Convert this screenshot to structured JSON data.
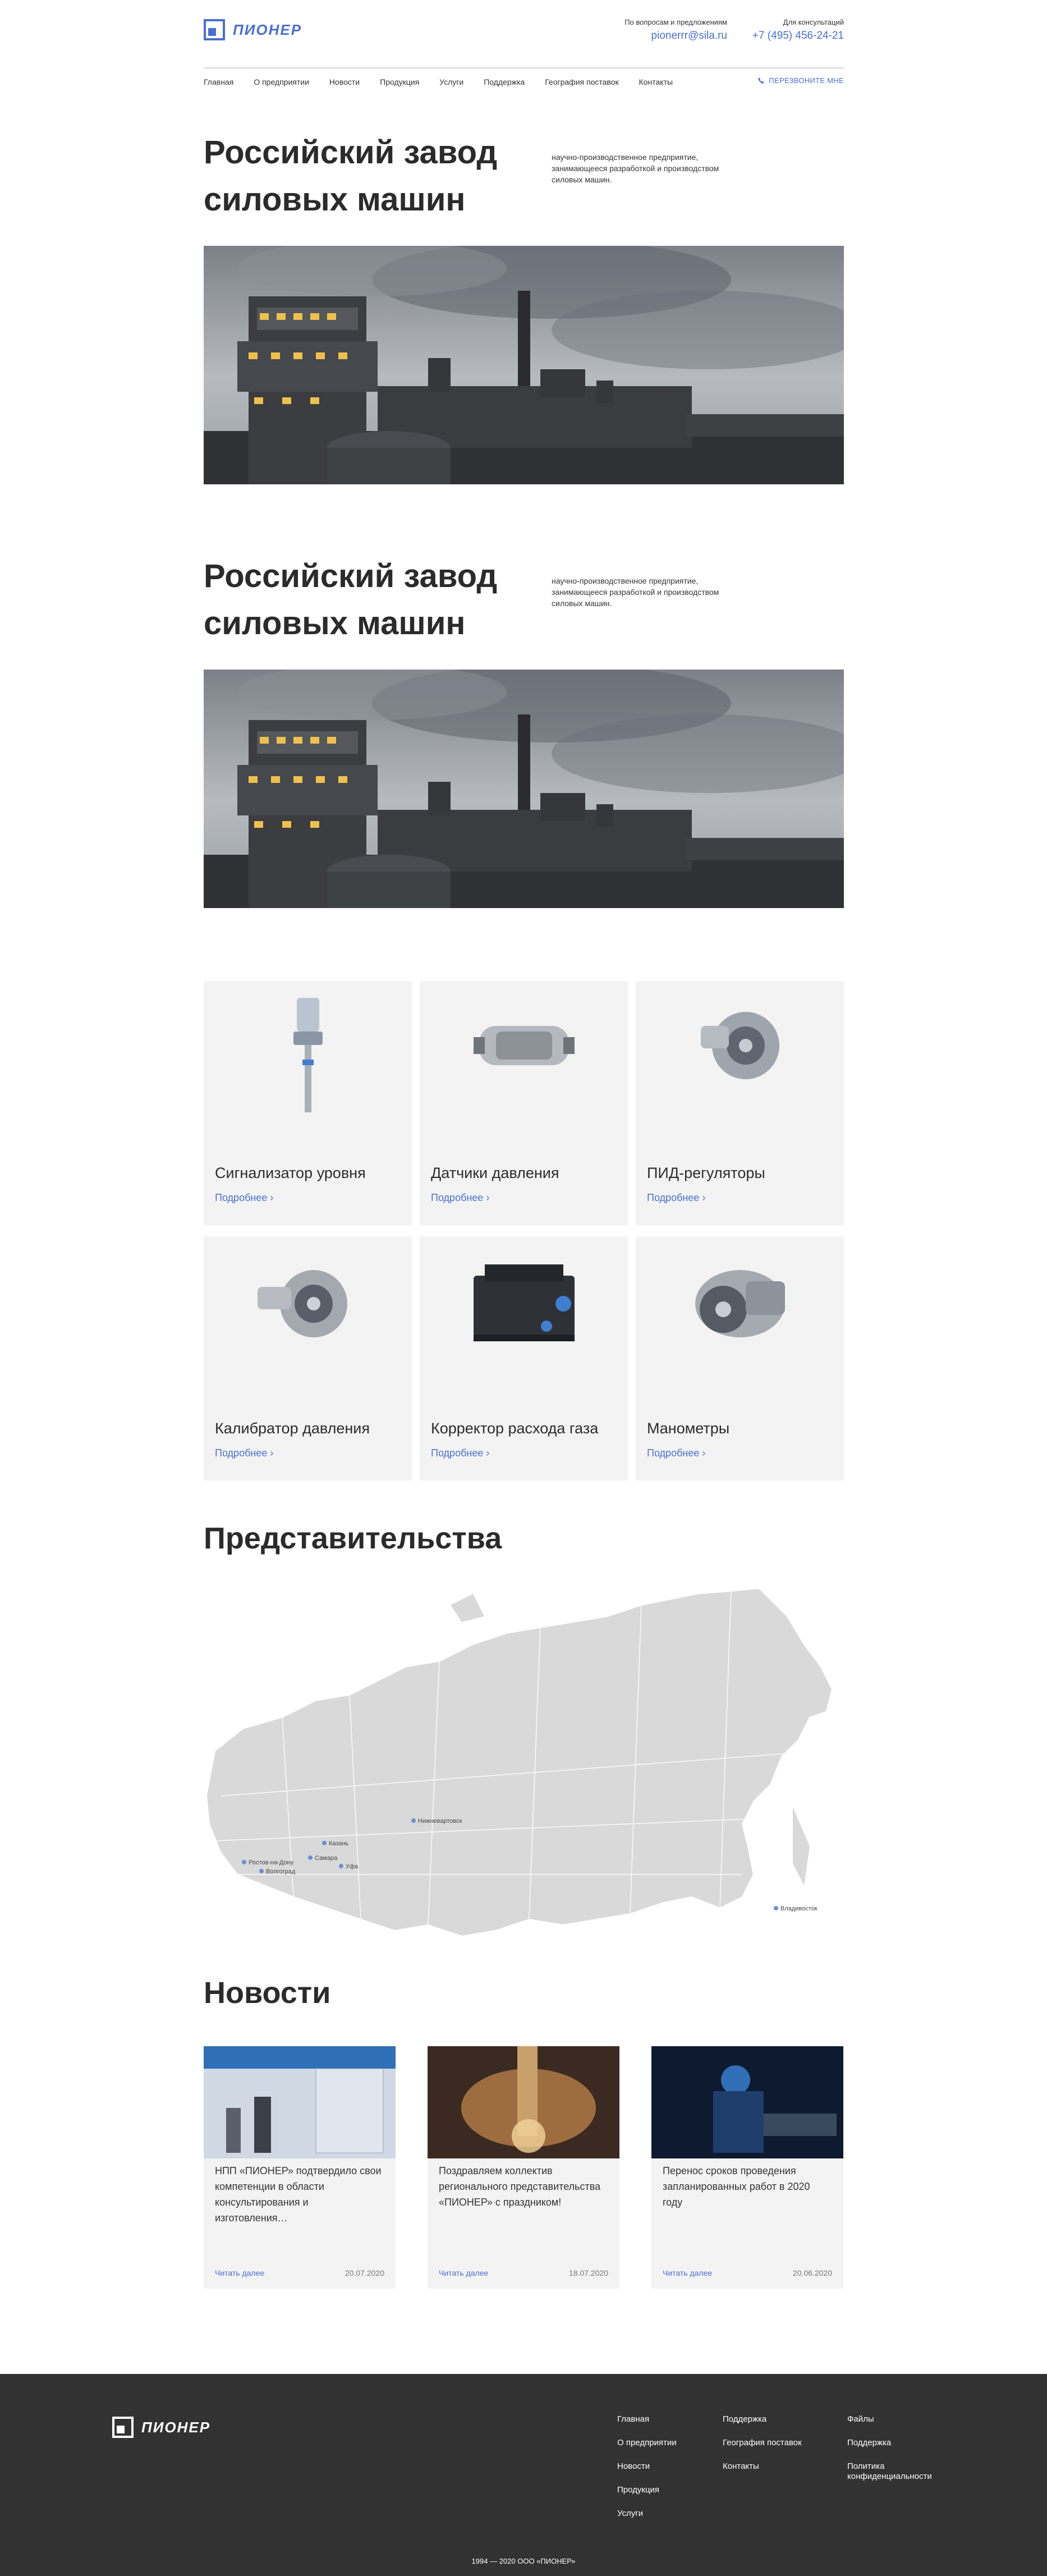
{
  "brand": {
    "name": "ПИОНЕР"
  },
  "header": {
    "email_label": "По вопросам и предложениям",
    "email": "pionerrr@sila.ru",
    "phone_label": "Для консультаций",
    "phone": "+7 (495) 456-24-21"
  },
  "nav": {
    "items": [
      "Главная",
      "О предприятии",
      "Новости",
      "Продукция",
      "Услуги",
      "Поддержка",
      "География поставок",
      "Контакты"
    ],
    "callback": "ПЕРЕЗВОНИТЕ МНЕ"
  },
  "heroes": [
    {
      "title_line1": "Российский завод",
      "title_line2": "силовых машин",
      "desc": "научно-производственное предприятие, занимающееся разработкой и производством силовых машин."
    },
    {
      "title_line1": "Российский завод",
      "title_line2": "силовых машин",
      "desc": "научно-производственное предприятие, занимающееся разработкой и производством силовых машин."
    }
  ],
  "products": [
    {
      "title": "Сигнализатор уровня",
      "more": "Подробнее",
      "icon": "level-sensor-icon"
    },
    {
      "title": "Датчики давления",
      "more": "Подробнее",
      "icon": "pressure-sensor-icon"
    },
    {
      "title": "ПИД-регуляторы",
      "more": "Подробнее",
      "icon": "turbocharger-icon"
    },
    {
      "title": "Калибратор давления",
      "more": "Подробнее",
      "icon": "turbocharger-icon"
    },
    {
      "title": "Корректор расхода газа",
      "more": "Подробнее",
      "icon": "engine-icon"
    },
    {
      "title": "Манометры",
      "more": "Подробнее",
      "icon": "turbine-icon"
    }
  ],
  "representations": {
    "title": "Представительства",
    "cities": [
      "Нижневартовск",
      "Казань",
      "Самара",
      "Ростов-на-Дону",
      "Волгоград",
      "Уфа",
      "Владивосток"
    ]
  },
  "news": {
    "title": "Новости",
    "items": [
      {
        "text": "НПП «ПИОНЕР» подтвердило свои компетенции в области консультирования и изготовления…",
        "link": "Читать далее",
        "date": "20.07.2020"
      },
      {
        "text": "Поздравляем коллектив регионального представительства «ПИОНЕР» с праздником!",
        "link": "Читать далее",
        "date": "18.07.2020"
      },
      {
        "text": "Перенос сроков проведения запланированных работ в 2020 году",
        "link": "Читать далее",
        "date": "20.06.2020"
      }
    ]
  },
  "footer": {
    "col1": [
      "Главная",
      "О предприятии",
      "Новости",
      "Продукция",
      "Услуги"
    ],
    "col2": [
      "Поддержка",
      "География поставок",
      "Контакты"
    ],
    "col3": [
      "Файлы",
      "Поддержка",
      "Политика конфиденциальности"
    ],
    "copyright": "1994 — 2020 ООО «ПИОНЕР»"
  },
  "colors": {
    "accent": "#4a6fd1",
    "card_bg": "#f3f3f3",
    "footer_bg": "#323232",
    "map_fill": "#d9d9d9"
  }
}
